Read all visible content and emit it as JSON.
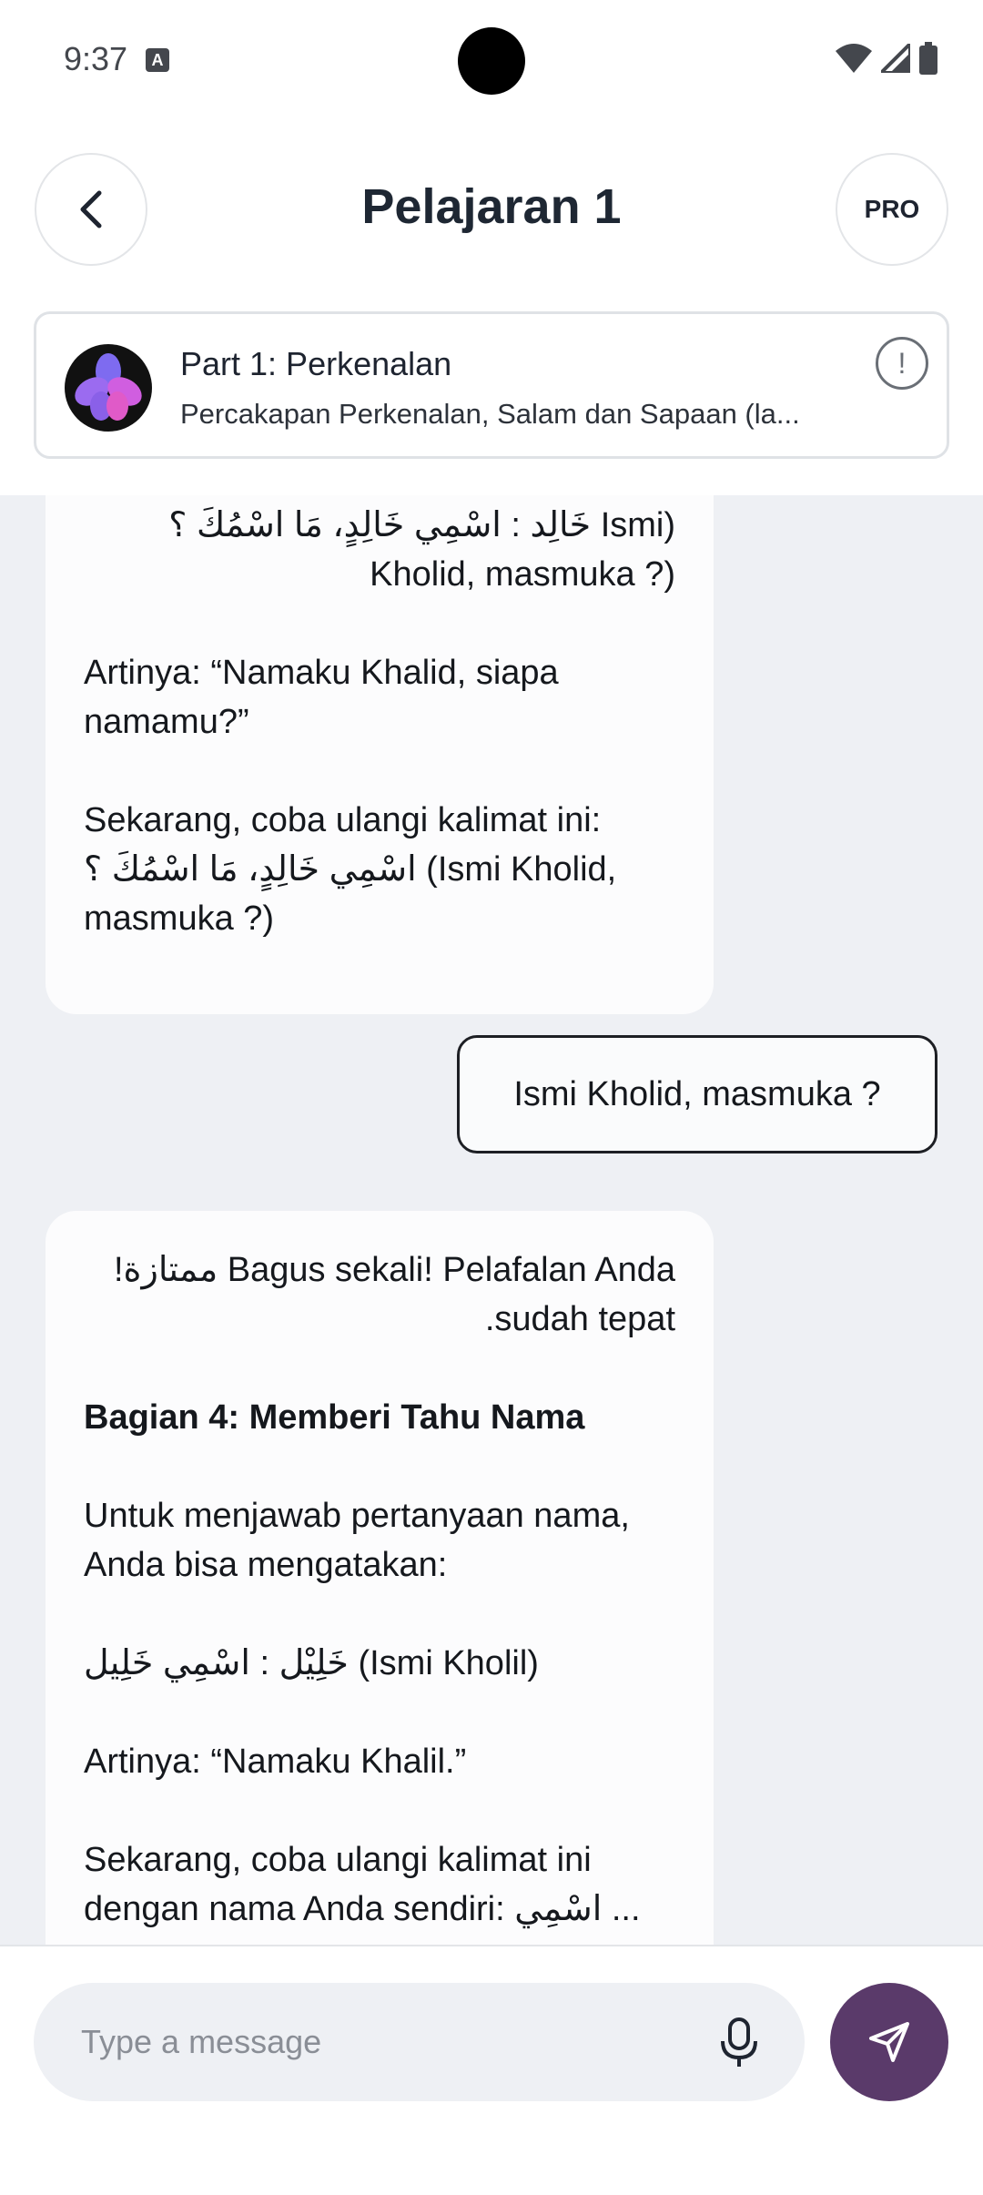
{
  "status_bar": {
    "time": "9:37"
  },
  "header": {
    "title": "Pelajaran 1",
    "pro_label": "PRO"
  },
  "lesson": {
    "title": "Part 1: Perkenalan",
    "subtitle": "Percakapan Perkenalan, Salam dan Sapaan (la..."
  },
  "messages": {
    "bot1": {
      "line1": "(Ismi خَالِد : اسْمِي خَالِدٍ، مَا اسْمُكَ ؟",
      "line2": "(? Kholid, masmuka",
      "meaning": "Artinya: “Namaku Khalid, siapa namamu?”",
      "prompt": "Sekarang, coba ulangi kalimat ini: اسْمِي خَالِدٍ، مَا اسْمُكَ ؟ (Ismi Kholid, masmuka ?)"
    },
    "user1": "Ismi Kholid, masmuka ?",
    "bot2": {
      "praise": "Bagus sekali! Pelafalan Anda ممتازة! sudah tepat.",
      "section_title": "Bagian 4: Memberi Tahu Nama",
      "instruction": "Untuk menjawab pertanyaan nama, Anda bisa mengatakan:",
      "example": "خَلِيْل : اسْمِي خَلِيل (Ismi Kholil)",
      "meaning": "Artinya: “Namaku Khalil.”",
      "prompt": "Sekarang, coba ulangi kalimat ini dengan nama Anda sendiri: اسْمِي ..."
    }
  },
  "composer": {
    "placeholder": "Type a message",
    "value": ""
  },
  "colors": {
    "send_button": "#5a3a6a",
    "chat_background": "#eef0f4",
    "bubble": "#fcfcfd"
  }
}
